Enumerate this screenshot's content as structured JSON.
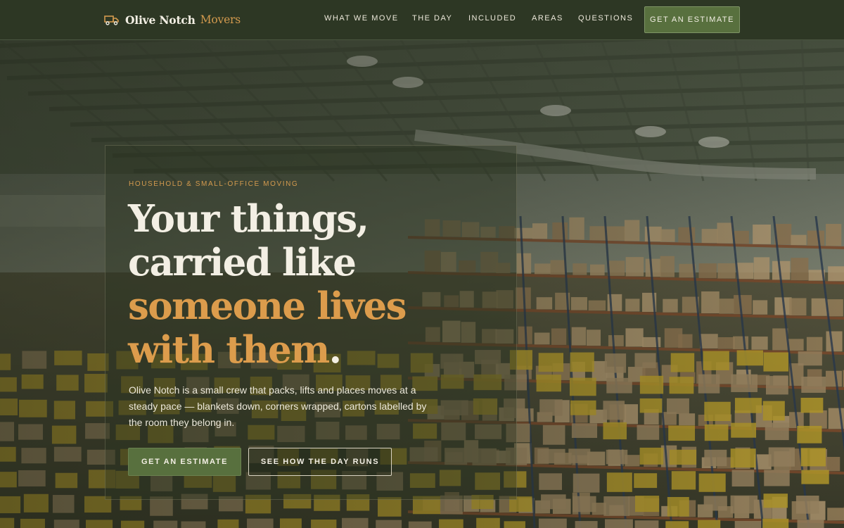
{
  "brand": {
    "name": "Olive Notch",
    "accent": "Movers",
    "icon": "truck-icon"
  },
  "nav": {
    "links": [
      "WHAT WE MOVE",
      "THE DAY",
      "INCLUDED",
      "AREAS",
      "QUESTIONS"
    ],
    "cta": "GET AN ESTIMATE"
  },
  "hero": {
    "eyebrow": "HOUSEHOLD & SMALL-OFFICE MOVING",
    "headline": {
      "line1": "Your things,",
      "line2": "carried like",
      "line3": "someone lives",
      "line4": "with them",
      "period": "."
    },
    "lede": "Olive Notch is a small crew that packs, lifts and places moves at a steady pace — blankets down, corners wrapped, cartons labelled by the room they belong in.",
    "primary_button": "GET AN ESTIMATE",
    "secondary_button": "SEE HOW THE DAY RUNS",
    "background": "warehouse-photo"
  },
  "colors": {
    "nav_bg": "#2d3724",
    "accent_orange": "#dc9c4c",
    "olive_button": "#58703e",
    "cream_text": "#f3efe4"
  }
}
